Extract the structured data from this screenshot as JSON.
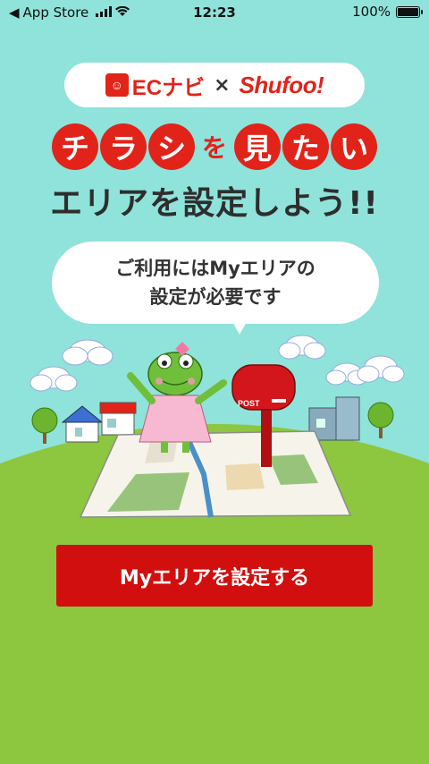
{
  "status_bar": {
    "back_app": "App Store",
    "time": "12:23",
    "battery": "100%"
  },
  "logos": {
    "ec_navi_text": "ECナビ",
    "times": "×",
    "shufoo": "Shufoo!"
  },
  "headline": {
    "line1_chars": [
      "チ",
      "ラ",
      "シ",
      "を",
      "見",
      "た",
      "い"
    ],
    "line2": "エリアを設定しよう!!"
  },
  "bubble": {
    "line1": "ご利用にはMyエリアの",
    "line2": "設定が必要です"
  },
  "illustration": {
    "post_label": "POST"
  },
  "cta": {
    "label": "Myエリアを設定する"
  },
  "colors": {
    "sky": "#8fe3da",
    "brand_red": "#e2231a",
    "button_red": "#d10f0f",
    "grass": "#8dc63f"
  }
}
